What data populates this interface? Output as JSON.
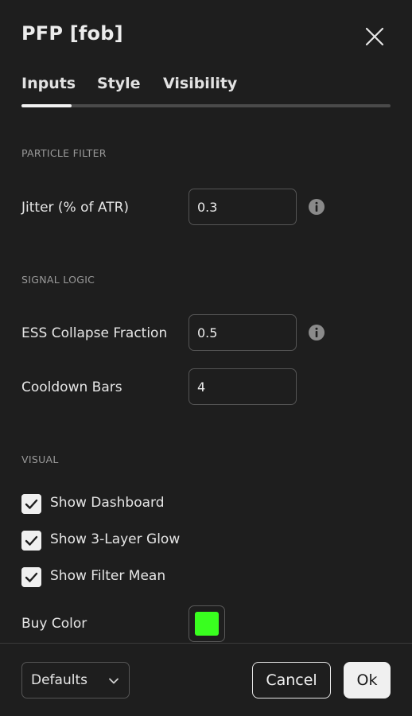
{
  "dialog": {
    "title": "PFP [fob]",
    "close_icon": "close-icon"
  },
  "tabs": [
    {
      "label": "Inputs",
      "active": true
    },
    {
      "label": "Style",
      "active": false
    },
    {
      "label": "Visibility",
      "active": false
    }
  ],
  "sections": {
    "particle_filter": {
      "heading": "PARTICLE FILTER",
      "jitter": {
        "label": "Jitter (% of ATR)",
        "value": "0.3",
        "info_icon": "info-icon"
      }
    },
    "signal_logic": {
      "heading": "SIGNAL LOGIC",
      "ess": {
        "label": "ESS Collapse Fraction",
        "value": "0.5",
        "info_icon": "info-icon"
      },
      "cooldown": {
        "label": "Cooldown Bars",
        "value": "4"
      }
    },
    "visual": {
      "heading": "VISUAL",
      "checkboxes": [
        {
          "label": "Show Dashboard",
          "checked": true
        },
        {
          "label": "Show 3-Layer Glow",
          "checked": true
        },
        {
          "label": "Show Filter Mean",
          "checked": true
        }
      ],
      "buy_color": {
        "label": "Buy Color",
        "color": "#39ff1f"
      }
    }
  },
  "footer": {
    "defaults_label": "Defaults",
    "cancel_label": "Cancel",
    "ok_label": "Ok"
  },
  "colors": {
    "background": "#1e1e1e",
    "text": "#e6e6e6",
    "muted": "#9a9a9a",
    "accent": "#f0f0f0"
  }
}
